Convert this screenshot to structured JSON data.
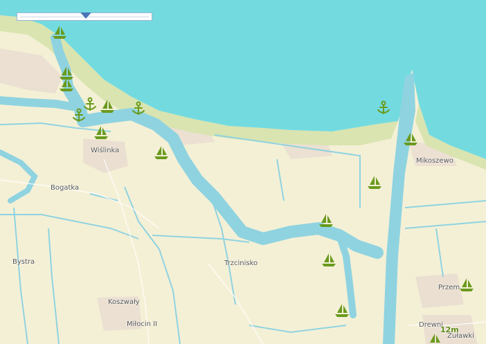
{
  "map": {
    "places": [
      {
        "name": "Wiślinka"
      },
      {
        "name": "Bogatka"
      },
      {
        "name": "Bystra"
      },
      {
        "name": "Trzcinisko"
      },
      {
        "name": "Koszwały"
      },
      {
        "name": "Miłocin II"
      },
      {
        "name": "Mikoszewo"
      },
      {
        "name": "Przem"
      },
      {
        "name": "Drewni"
      },
      {
        "name": "Żuławki"
      }
    ],
    "depth_badge": "12m",
    "colors": {
      "sea": "#73dbe0",
      "land": "#f4f0d6",
      "beach": "#d8e2b0",
      "river": "#8fd3e0",
      "marker": "#6a9a1e",
      "built_up": "#e6d7cc"
    },
    "marker_icons": [
      "sailboat-icon",
      "anchor-icon"
    ],
    "zoom_control": {
      "icon": "zoom-slider"
    }
  }
}
